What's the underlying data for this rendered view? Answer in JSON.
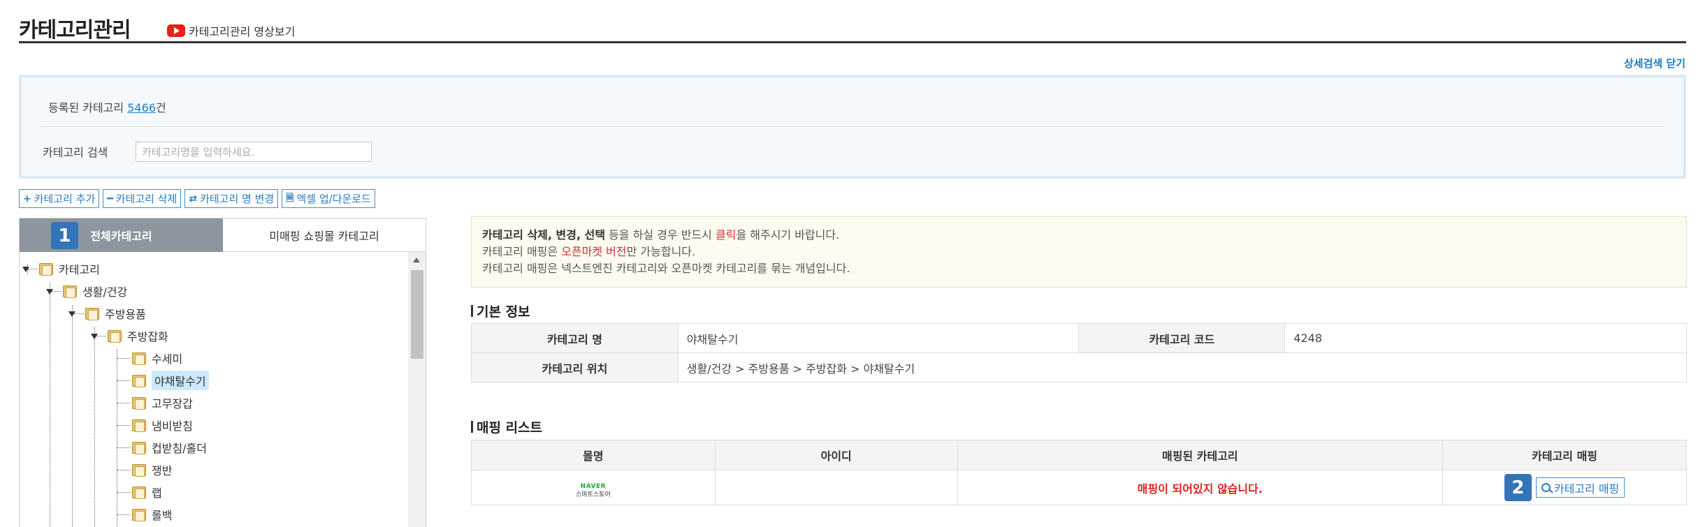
{
  "header": {
    "title": "카테고리관리",
    "video_link": "카테고리관리 영상보기",
    "detail_toggle": "상세검색 닫기"
  },
  "search": {
    "registered_prefix": "등록된 카테고리 ",
    "registered_count": "5466",
    "registered_suffix": "건",
    "label": "카테고리 검색",
    "placeholder": "카테고리명을 입력하세요."
  },
  "toolbar": {
    "add": "카테고리 추가",
    "delete": "카테고리 삭제",
    "rename": "카테고리 명 변경",
    "excel": "엑셀 업/다운로드"
  },
  "tree_tabs": {
    "badge": "1",
    "all": "전체카테고리",
    "unmapped": "미매핑 쇼핑몰 카테고리"
  },
  "tree": {
    "root": "카테고리",
    "level1": "생활/건강",
    "level2": "주방용품",
    "level3": "주방잡화",
    "leaves": [
      "수세미",
      "야채탈수기",
      "고무장갑",
      "냄비받침",
      "컵받침/홀더",
      "쟁반",
      "랩",
      "롤백"
    ],
    "selected": "야채탈수기"
  },
  "notice": {
    "line1_bold": "카테고리 삭제, 변경, 선택",
    "line1_mid": " 등을 하실 경우 반드시 ",
    "line1_hl": "클릭",
    "line1_end": "을 해주시기 바랍니다.",
    "line2_start": "카테고리 매핑은 ",
    "line2_hl": "오픈마켓 버전",
    "line2_end": "만 가능합니다.",
    "line3": "카테고리 매핑은 넥스트엔진 카테고리와 오픈마켓 카테고리를 묶는 개념입니다."
  },
  "basic_info": {
    "title": "기본 정보",
    "name_label": "카테고리 명",
    "name_value": "야채탈수기",
    "code_label": "카테고리 코드",
    "code_value": "4248",
    "location_label": "카테고리 위치",
    "location_value": "생활/건강 > 주방용품 > 주방잡화 > 야채탈수기"
  },
  "mapping": {
    "title": "매핑 리스트",
    "columns": [
      "몰명",
      "아이디",
      "매핑된 카테고리",
      "카테고리 매핑"
    ],
    "row": {
      "mall_logo_top": "NAVER",
      "mall_logo_bottom": "스마트스토어",
      "id": "",
      "status": "매핑이 되어있지 않습니다.",
      "badge": "2",
      "button": "카테고리 매핑"
    }
  }
}
